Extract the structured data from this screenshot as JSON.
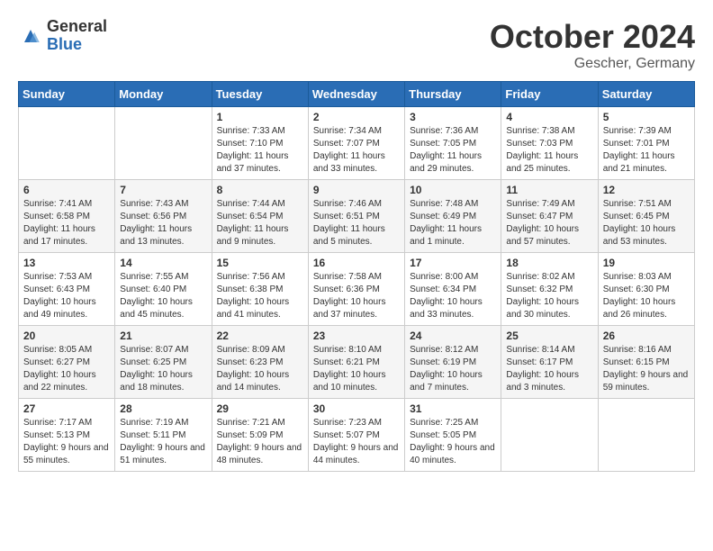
{
  "header": {
    "logo_general": "General",
    "logo_blue": "Blue",
    "month_title": "October 2024",
    "location": "Gescher, Germany"
  },
  "weekdays": [
    "Sunday",
    "Monday",
    "Tuesday",
    "Wednesday",
    "Thursday",
    "Friday",
    "Saturday"
  ],
  "weeks": [
    [
      {
        "day": "",
        "sunrise": "",
        "sunset": "",
        "daylight": ""
      },
      {
        "day": "",
        "sunrise": "",
        "sunset": "",
        "daylight": ""
      },
      {
        "day": "1",
        "sunrise": "Sunrise: 7:33 AM",
        "sunset": "Sunset: 7:10 PM",
        "daylight": "Daylight: 11 hours and 37 minutes."
      },
      {
        "day": "2",
        "sunrise": "Sunrise: 7:34 AM",
        "sunset": "Sunset: 7:07 PM",
        "daylight": "Daylight: 11 hours and 33 minutes."
      },
      {
        "day": "3",
        "sunrise": "Sunrise: 7:36 AM",
        "sunset": "Sunset: 7:05 PM",
        "daylight": "Daylight: 11 hours and 29 minutes."
      },
      {
        "day": "4",
        "sunrise": "Sunrise: 7:38 AM",
        "sunset": "Sunset: 7:03 PM",
        "daylight": "Daylight: 11 hours and 25 minutes."
      },
      {
        "day": "5",
        "sunrise": "Sunrise: 7:39 AM",
        "sunset": "Sunset: 7:01 PM",
        "daylight": "Daylight: 11 hours and 21 minutes."
      }
    ],
    [
      {
        "day": "6",
        "sunrise": "Sunrise: 7:41 AM",
        "sunset": "Sunset: 6:58 PM",
        "daylight": "Daylight: 11 hours and 17 minutes."
      },
      {
        "day": "7",
        "sunrise": "Sunrise: 7:43 AM",
        "sunset": "Sunset: 6:56 PM",
        "daylight": "Daylight: 11 hours and 13 minutes."
      },
      {
        "day": "8",
        "sunrise": "Sunrise: 7:44 AM",
        "sunset": "Sunset: 6:54 PM",
        "daylight": "Daylight: 11 hours and 9 minutes."
      },
      {
        "day": "9",
        "sunrise": "Sunrise: 7:46 AM",
        "sunset": "Sunset: 6:51 PM",
        "daylight": "Daylight: 11 hours and 5 minutes."
      },
      {
        "day": "10",
        "sunrise": "Sunrise: 7:48 AM",
        "sunset": "Sunset: 6:49 PM",
        "daylight": "Daylight: 11 hours and 1 minute."
      },
      {
        "day": "11",
        "sunrise": "Sunrise: 7:49 AM",
        "sunset": "Sunset: 6:47 PM",
        "daylight": "Daylight: 10 hours and 57 minutes."
      },
      {
        "day": "12",
        "sunrise": "Sunrise: 7:51 AM",
        "sunset": "Sunset: 6:45 PM",
        "daylight": "Daylight: 10 hours and 53 minutes."
      }
    ],
    [
      {
        "day": "13",
        "sunrise": "Sunrise: 7:53 AM",
        "sunset": "Sunset: 6:43 PM",
        "daylight": "Daylight: 10 hours and 49 minutes."
      },
      {
        "day": "14",
        "sunrise": "Sunrise: 7:55 AM",
        "sunset": "Sunset: 6:40 PM",
        "daylight": "Daylight: 10 hours and 45 minutes."
      },
      {
        "day": "15",
        "sunrise": "Sunrise: 7:56 AM",
        "sunset": "Sunset: 6:38 PM",
        "daylight": "Daylight: 10 hours and 41 minutes."
      },
      {
        "day": "16",
        "sunrise": "Sunrise: 7:58 AM",
        "sunset": "Sunset: 6:36 PM",
        "daylight": "Daylight: 10 hours and 37 minutes."
      },
      {
        "day": "17",
        "sunrise": "Sunrise: 8:00 AM",
        "sunset": "Sunset: 6:34 PM",
        "daylight": "Daylight: 10 hours and 33 minutes."
      },
      {
        "day": "18",
        "sunrise": "Sunrise: 8:02 AM",
        "sunset": "Sunset: 6:32 PM",
        "daylight": "Daylight: 10 hours and 30 minutes."
      },
      {
        "day": "19",
        "sunrise": "Sunrise: 8:03 AM",
        "sunset": "Sunset: 6:30 PM",
        "daylight": "Daylight: 10 hours and 26 minutes."
      }
    ],
    [
      {
        "day": "20",
        "sunrise": "Sunrise: 8:05 AM",
        "sunset": "Sunset: 6:27 PM",
        "daylight": "Daylight: 10 hours and 22 minutes."
      },
      {
        "day": "21",
        "sunrise": "Sunrise: 8:07 AM",
        "sunset": "Sunset: 6:25 PM",
        "daylight": "Daylight: 10 hours and 18 minutes."
      },
      {
        "day": "22",
        "sunrise": "Sunrise: 8:09 AM",
        "sunset": "Sunset: 6:23 PM",
        "daylight": "Daylight: 10 hours and 14 minutes."
      },
      {
        "day": "23",
        "sunrise": "Sunrise: 8:10 AM",
        "sunset": "Sunset: 6:21 PM",
        "daylight": "Daylight: 10 hours and 10 minutes."
      },
      {
        "day": "24",
        "sunrise": "Sunrise: 8:12 AM",
        "sunset": "Sunset: 6:19 PM",
        "daylight": "Daylight: 10 hours and 7 minutes."
      },
      {
        "day": "25",
        "sunrise": "Sunrise: 8:14 AM",
        "sunset": "Sunset: 6:17 PM",
        "daylight": "Daylight: 10 hours and 3 minutes."
      },
      {
        "day": "26",
        "sunrise": "Sunrise: 8:16 AM",
        "sunset": "Sunset: 6:15 PM",
        "daylight": "Daylight: 9 hours and 59 minutes."
      }
    ],
    [
      {
        "day": "27",
        "sunrise": "Sunrise: 7:17 AM",
        "sunset": "Sunset: 5:13 PM",
        "daylight": "Daylight: 9 hours and 55 minutes."
      },
      {
        "day": "28",
        "sunrise": "Sunrise: 7:19 AM",
        "sunset": "Sunset: 5:11 PM",
        "daylight": "Daylight: 9 hours and 51 minutes."
      },
      {
        "day": "29",
        "sunrise": "Sunrise: 7:21 AM",
        "sunset": "Sunset: 5:09 PM",
        "daylight": "Daylight: 9 hours and 48 minutes."
      },
      {
        "day": "30",
        "sunrise": "Sunrise: 7:23 AM",
        "sunset": "Sunset: 5:07 PM",
        "daylight": "Daylight: 9 hours and 44 minutes."
      },
      {
        "day": "31",
        "sunrise": "Sunrise: 7:25 AM",
        "sunset": "Sunset: 5:05 PM",
        "daylight": "Daylight: 9 hours and 40 minutes."
      },
      {
        "day": "",
        "sunrise": "",
        "sunset": "",
        "daylight": ""
      },
      {
        "day": "",
        "sunrise": "",
        "sunset": "",
        "daylight": ""
      }
    ]
  ]
}
